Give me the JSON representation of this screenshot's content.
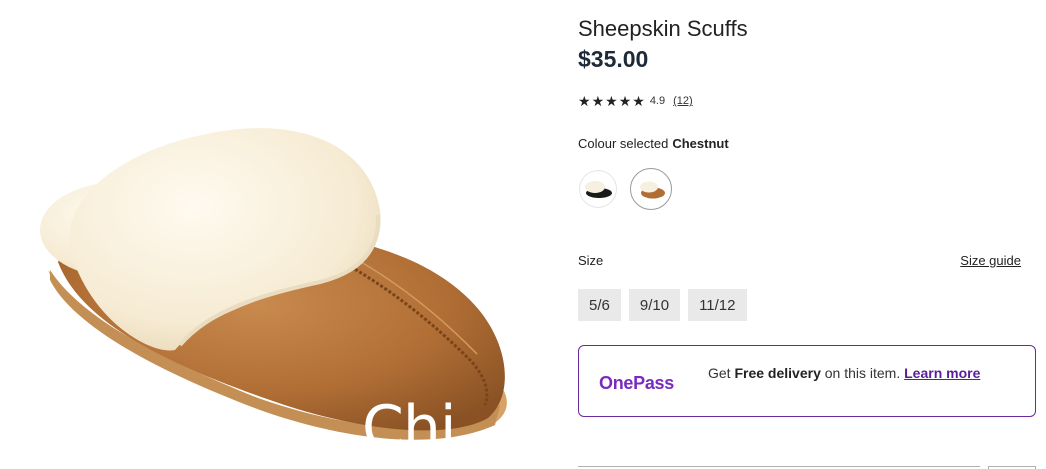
{
  "product": {
    "title": "Sheepskin Scuffs",
    "price": "$35.00",
    "rating": "4.9",
    "review_count": "(12)",
    "stars": 5
  },
  "colour": {
    "label": "Colour selected",
    "selected": "Chestnut",
    "options": [
      "black-slipper",
      "chestnut-slipper"
    ]
  },
  "size": {
    "label": "Size",
    "guide_label": "Size guide",
    "options": [
      "5/6",
      "9/10",
      "11/12"
    ]
  },
  "onepass": {
    "logo": "OnePass",
    "text_prefix": "Get",
    "text_bold": "Free delivery",
    "text_suffix": "on this item.",
    "link": "Learn more"
  },
  "image_overlay_text": "Chi",
  "colors": {
    "accent_purple": "#7a2bbf",
    "border_purple": "#6b2a9b",
    "size_button_bg": "#e9e9e9",
    "chestnut": "#b8733a",
    "fleece": "#fbf3e2"
  }
}
